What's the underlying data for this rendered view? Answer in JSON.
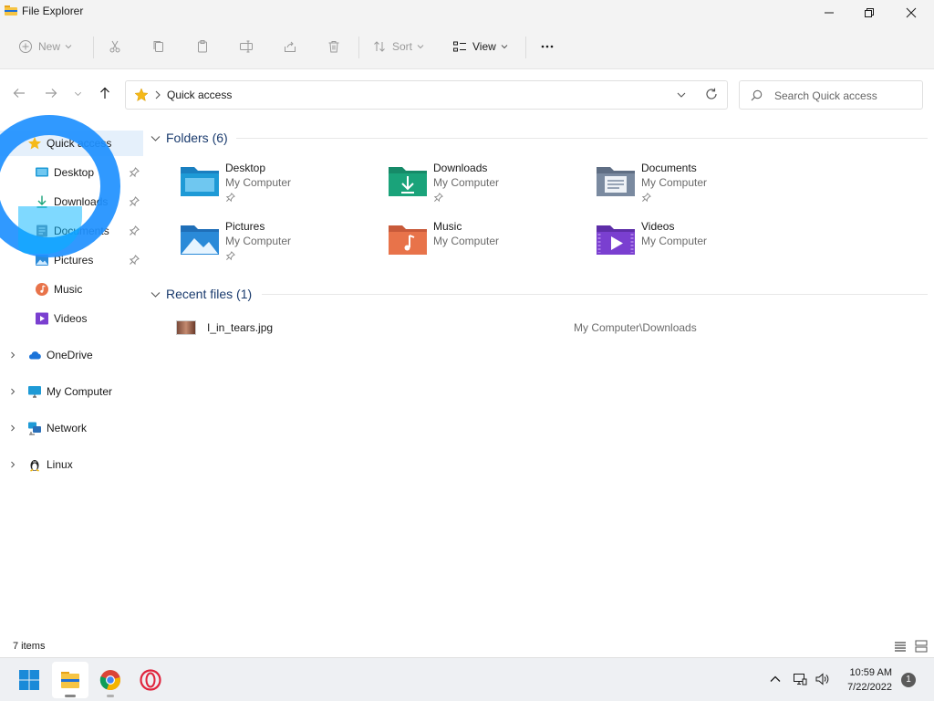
{
  "window": {
    "title": "File Explorer"
  },
  "toolbar": {
    "new_label": "New",
    "sort_label": "Sort",
    "view_label": "View"
  },
  "address": {
    "path": "Quick access",
    "search_placeholder": "Search Quick access"
  },
  "sidebar": {
    "items": [
      {
        "label": "Quick access",
        "icon": "star-icon"
      },
      {
        "label": "Desktop",
        "icon": "desktop-icon",
        "pinned": true
      },
      {
        "label": "Downloads",
        "icon": "download-icon",
        "pinned": true
      },
      {
        "label": "Documents",
        "icon": "documents-icon",
        "pinned": true
      },
      {
        "label": "Pictures",
        "icon": "pictures-icon",
        "pinned": true
      },
      {
        "label": "Music",
        "icon": "music-icon"
      },
      {
        "label": "Videos",
        "icon": "videos-icon"
      },
      {
        "label": "OneDrive",
        "icon": "cloud-icon"
      },
      {
        "label": "My Computer",
        "icon": "monitor-icon"
      },
      {
        "label": "Network",
        "icon": "network-icon"
      },
      {
        "label": "Linux",
        "icon": "linux-penguin-icon"
      }
    ]
  },
  "main": {
    "folders_header": "Folders (6)",
    "folders": [
      {
        "name": "Desktop",
        "location": "My Computer",
        "color": "#1e9ad6"
      },
      {
        "name": "Downloads",
        "location": "My Computer",
        "color": "#1aa37a"
      },
      {
        "name": "Documents",
        "location": "My Computer",
        "color": "#7a8aa0"
      },
      {
        "name": "Pictures",
        "location": "My Computer",
        "color": "#2a8ad8"
      },
      {
        "name": "Music",
        "location": "My Computer",
        "color": "#e8734a"
      },
      {
        "name": "Videos",
        "location": "My Computer",
        "color": "#7a3fd0"
      }
    ],
    "recent_header": "Recent files (1)",
    "recent_files": [
      {
        "name": "I_in_tears.jpg",
        "location": "My Computer\\Downloads"
      }
    ]
  },
  "status": {
    "item_count": "7 items"
  },
  "taskbar": {
    "time": "10:59 AM",
    "date": "7/22/2022",
    "notifications": "1"
  }
}
